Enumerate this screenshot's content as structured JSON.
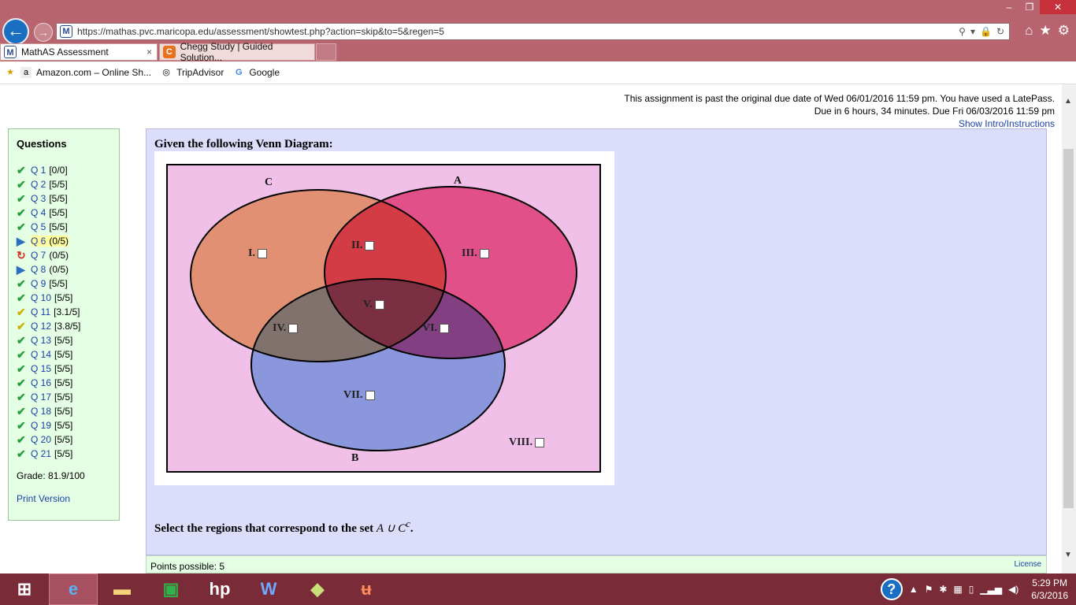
{
  "browser": {
    "address": "https://mathas.pvc.maricopa.edu/assessment/showtest.php?action=skip&to=5&regen=5",
    "tabs": [
      {
        "label": "MathAS Assessment",
        "close": "×"
      },
      {
        "label": "Chegg Study | Guided Solution..."
      }
    ],
    "favorites": [
      "Amazon.com – Online Sh...",
      "TripAdvisor",
      "Google"
    ]
  },
  "notice": {
    "past_due": "This assignment is past the original due date of Wed 06/01/2016 11:59 pm. You have used a LatePass.",
    "due_in": "Due in 6 hours, 34 minutes. Due Fri 06/03/2016 11:59 pm",
    "show_intro": "Show Intro/Instructions"
  },
  "sidebar": {
    "heading": "Questions",
    "questions": [
      {
        "label": "Q 1",
        "score": "[0/0]",
        "status": "check"
      },
      {
        "label": "Q 2",
        "score": "[5/5]",
        "status": "check"
      },
      {
        "label": "Q 3",
        "score": "[5/5]",
        "status": "check"
      },
      {
        "label": "Q 4",
        "score": "[5/5]",
        "status": "check"
      },
      {
        "label": "Q 5",
        "score": "[5/5]",
        "status": "check"
      },
      {
        "label": "Q 6",
        "score": "(0/5)",
        "status": "current"
      },
      {
        "label": "Q 7",
        "score": "(0/5)",
        "status": "retry"
      },
      {
        "label": "Q 8",
        "score": "(0/5)",
        "status": "open"
      },
      {
        "label": "Q 9",
        "score": "[5/5]",
        "status": "check"
      },
      {
        "label": "Q 10",
        "score": "[5/5]",
        "status": "check"
      },
      {
        "label": "Q 11",
        "score": "[3.1/5]",
        "status": "partial"
      },
      {
        "label": "Q 12",
        "score": "[3.8/5]",
        "status": "partial"
      },
      {
        "label": "Q 13",
        "score": "[5/5]",
        "status": "check"
      },
      {
        "label": "Q 14",
        "score": "[5/5]",
        "status": "check"
      },
      {
        "label": "Q 15",
        "score": "[5/5]",
        "status": "check"
      },
      {
        "label": "Q 16",
        "score": "[5/5]",
        "status": "check"
      },
      {
        "label": "Q 17",
        "score": "[5/5]",
        "status": "check"
      },
      {
        "label": "Q 18",
        "score": "[5/5]",
        "status": "check"
      },
      {
        "label": "Q 19",
        "score": "[5/5]",
        "status": "check"
      },
      {
        "label": "Q 20",
        "score": "[5/5]",
        "status": "check"
      },
      {
        "label": "Q 21",
        "score": "[5/5]",
        "status": "check"
      }
    ],
    "grade": "Grade: 81.9/100",
    "print_version": "Print Version"
  },
  "question": {
    "prompt": "Given the following Venn Diagram:",
    "set_labels": {
      "a": "A",
      "b": "B",
      "c": "C"
    },
    "regions": [
      "I.",
      "II.",
      "III.",
      "IV.",
      "V.",
      "VI.",
      "VII.",
      "VIII."
    ],
    "select_text": "Select the regions that correspond to the set",
    "set_expr": "A ∪ C",
    "set_expr_sup": "c",
    "period": ".",
    "colors": {
      "c": "#f0c080",
      "a": "#f05a8c",
      "b": "#80c0f0",
      "universe": "#f0c0e8"
    }
  },
  "footer": {
    "points": "Points possible: 5",
    "license": "License"
  },
  "taskbar": {
    "time": "5:29 PM",
    "date": "6/3/2016"
  }
}
